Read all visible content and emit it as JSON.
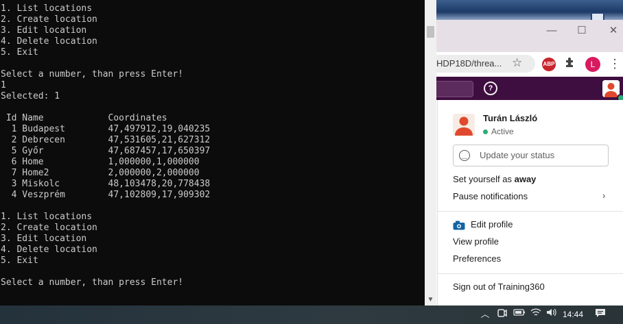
{
  "console": {
    "text": "1. List locations\n2. Create location\n3. Edit location\n4. Delete location\n5. Exit\n\nSelect a number, than press Enter!\n1\nSelected: 1\n\n Id Name            Coordinates\n  1 Budapest        47,497912,19,040235\n  2 Debrecen        47,531605,21,627312\n  5 Győr            47,687457,17,650397\n  6 Home            1,000000,1,000000\n  7 Home2           2,000000,2,000000\n  3 Miskolc         48,103478,20,778438\n  4 Veszprém        47,102809,17,909302\n\n1. List locations\n2. Create location\n3. Edit location\n4. Delete location\n5. Exit\n\nSelect a number, than press Enter!"
  },
  "browser": {
    "url": "HDP18D/threa...",
    "extensions": {
      "abp_label": "ABP"
    },
    "profile_initial": "L",
    "window_controls": {
      "minimize": "—",
      "maximize": "☐",
      "close": "✕"
    }
  },
  "slack": {
    "help_label": "?",
    "menu": {
      "user_name": "Turán László",
      "status": "Active",
      "status_placeholder": "Update your status",
      "set_away_prefix": "Set yourself as ",
      "set_away_bold": "away",
      "pause_notifications": "Pause notifications",
      "edit_profile": "Edit profile",
      "view_profile": "View profile",
      "preferences": "Preferences",
      "sign_out": "Sign out of Training360"
    }
  },
  "taskbar": {
    "time": "14:44",
    "icons": [
      "chevron-up-icon",
      "meet-icon",
      "battery-icon",
      "wifi-icon",
      "volume-icon",
      "notification-icon"
    ]
  },
  "colors": {
    "console_bg": "#0c0c0c",
    "console_fg": "#cccccc",
    "slack_aubergine": "#3f0e40",
    "presence_green": "#2bac76"
  }
}
